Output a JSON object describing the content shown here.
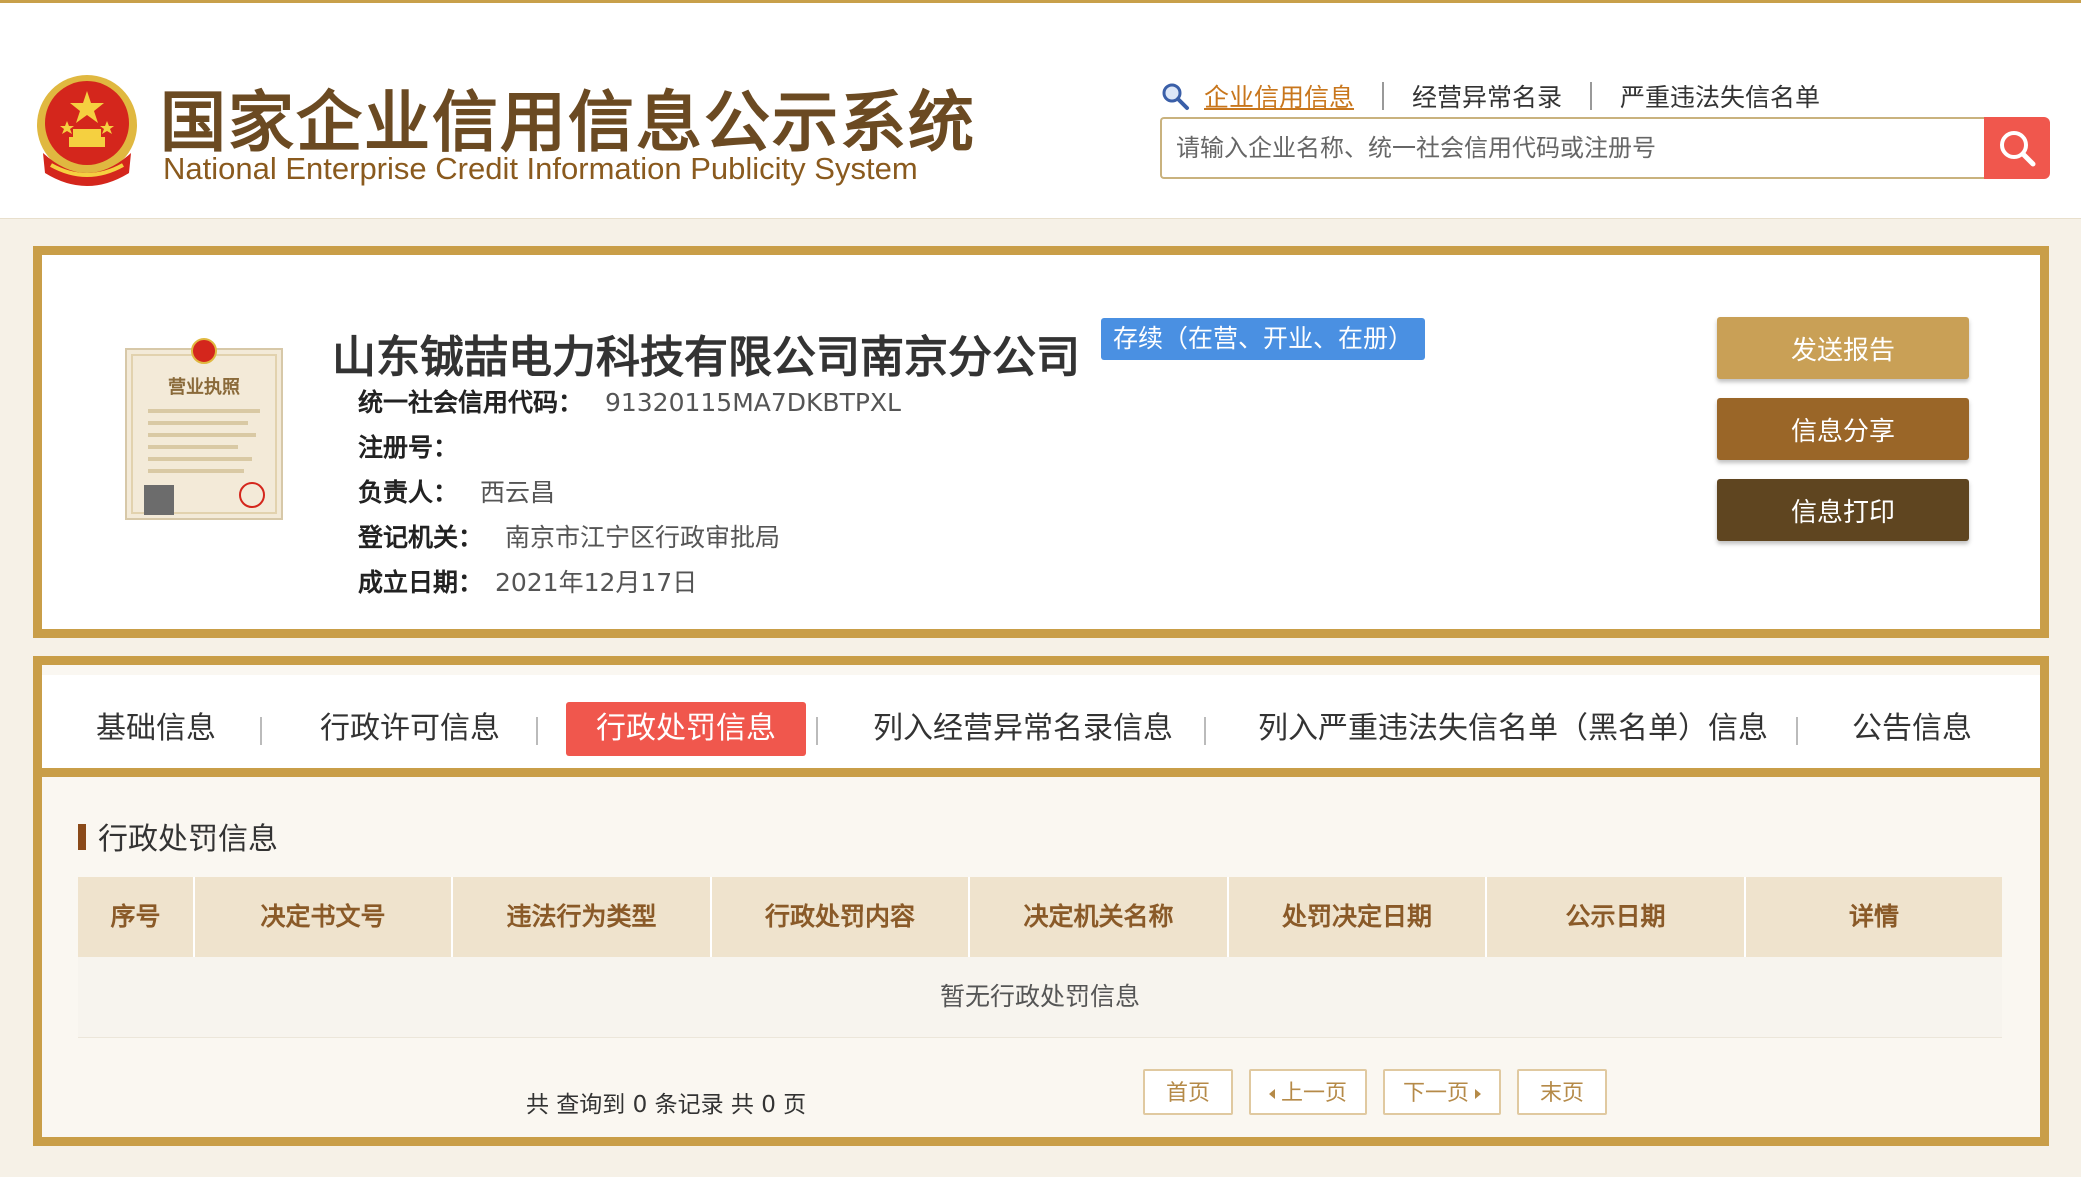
{
  "header": {
    "title_cn": "国家企业信用信息公示系统",
    "title_en": "National Enterprise Credit Information Publicity System",
    "nav": [
      "企业信用信息",
      "经营异常名录",
      "严重违法失信名单"
    ],
    "search_placeholder": "请输入企业名称、统一社会信用代码或注册号"
  },
  "company": {
    "name": "山东铖喆电力科技有限公司南京分公司",
    "status": "存续（在营、开业、在册）",
    "fields": [
      {
        "label": "统一社会信用代码：",
        "value": "91320115MA7DKBTPXL"
      },
      {
        "label": "注册号：",
        "value": ""
      },
      {
        "label": "负责人：",
        "value": "西云昌"
      },
      {
        "label": "登记机关：",
        "value": "南京市江宁区行政审批局"
      },
      {
        "label": "成立日期：",
        "value": "2021年12月17日"
      }
    ],
    "license_title": "营业执照",
    "actions": [
      "发送报告",
      "信息分享",
      "信息打印"
    ]
  },
  "tabs": [
    "基础信息",
    "行政许可信息",
    "行政处罚信息",
    "列入经营异常名录信息",
    "列入严重违法失信名单（黑名单）信息",
    "公告信息"
  ],
  "active_tab": "行政处罚信息",
  "section": {
    "title": "行政处罚信息",
    "columns": [
      "序号",
      "决定书文号",
      "违法行为类型",
      "行政处罚内容",
      "决定机关名称",
      "处罚决定日期",
      "公示日期",
      "详情"
    ],
    "empty_text": "暂无行政处罚信息"
  },
  "pager": {
    "summary": "共 查询到 0 条记录 共 0 页",
    "first": "首页",
    "prev": "上一页",
    "next": "下一页",
    "last": "末页"
  },
  "colors": {
    "accent_gold": "#c99e48",
    "active_red": "#f0574d",
    "status_blue": "#4a90e2"
  }
}
